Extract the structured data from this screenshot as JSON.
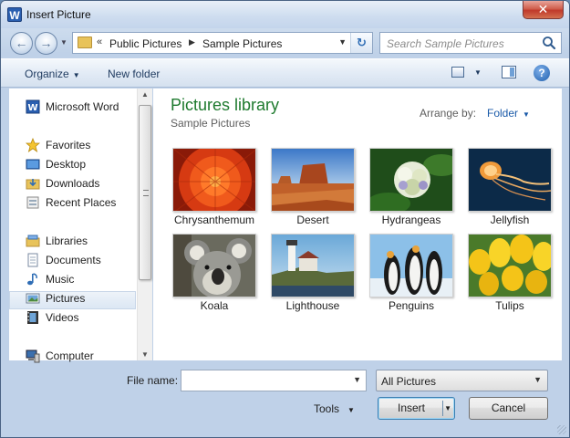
{
  "window": {
    "title": "Insert Picture",
    "app_icon_letter": "W",
    "close_glyph": "✕"
  },
  "address": {
    "prefix": "«",
    "crumbs": [
      "Public Pictures",
      "Sample Pictures"
    ]
  },
  "search": {
    "placeholder": "Search Sample Pictures"
  },
  "toolbar": {
    "organize": "Organize",
    "new_folder": "New folder",
    "help": "?"
  },
  "nav": {
    "items": [
      {
        "label": "Microsoft Word",
        "icon": "word-icon"
      },
      {
        "label": "Favorites",
        "icon": "star-icon"
      },
      {
        "label": "Desktop",
        "icon": "desktop-icon"
      },
      {
        "label": "Downloads",
        "icon": "downloads-folder-icon"
      },
      {
        "label": "Recent Places",
        "icon": "recent-places-icon"
      },
      {
        "label": "Libraries",
        "icon": "libraries-icon"
      },
      {
        "label": "Documents",
        "icon": "documents-icon"
      },
      {
        "label": "Music",
        "icon": "music-icon"
      },
      {
        "label": "Pictures",
        "icon": "pictures-icon"
      },
      {
        "label": "Videos",
        "icon": "videos-icon"
      },
      {
        "label": "Computer",
        "icon": "computer-icon"
      }
    ],
    "selected": "Pictures"
  },
  "content": {
    "library_title": "Pictures library",
    "library_subtitle": "Sample Pictures",
    "arrange_label": "Arrange by:",
    "arrange_value": "Folder",
    "files": [
      {
        "name": "Chrysanthemum"
      },
      {
        "name": "Desert"
      },
      {
        "name": "Hydrangeas"
      },
      {
        "name": "Jellyfish"
      },
      {
        "name": "Koala"
      },
      {
        "name": "Lighthouse"
      },
      {
        "name": "Penguins"
      },
      {
        "name": "Tulips"
      }
    ]
  },
  "footer": {
    "file_name_label": "File name:",
    "file_name_value": "",
    "filter": "All Pictures",
    "tools": "Tools",
    "insert": "Insert",
    "cancel": "Cancel"
  },
  "colors": {
    "library_title": "#1e7a2e",
    "link": "#1a5aa8",
    "close_button": "#c0392b"
  }
}
